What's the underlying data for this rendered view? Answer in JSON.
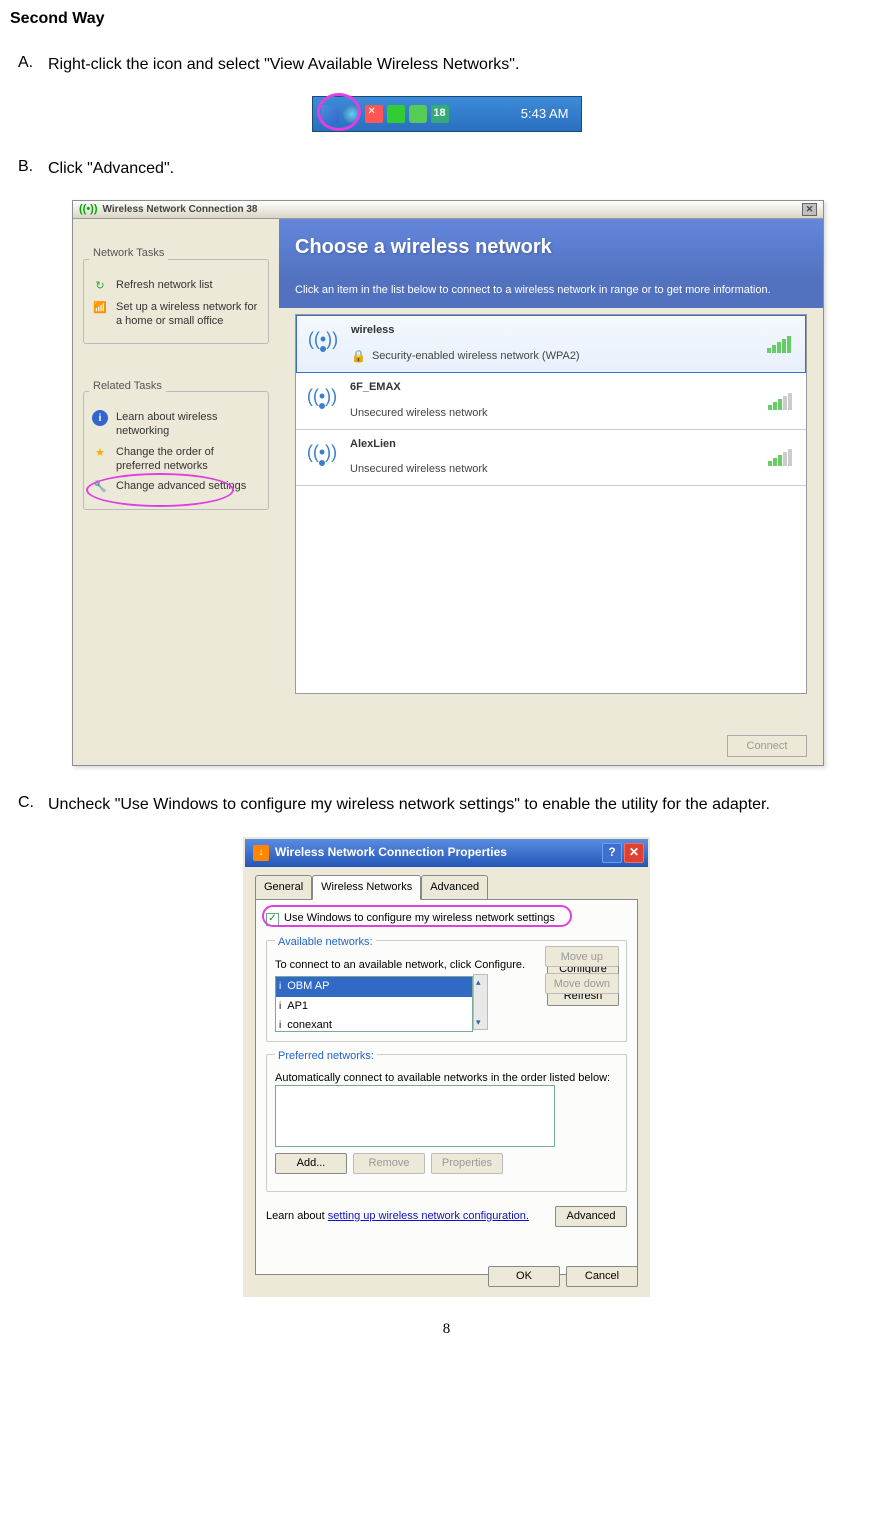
{
  "doc": {
    "heading": "Second Way",
    "stepA_letter": "A.",
    "stepA_text": "Right-click the icon and select \"View Available Wireless Networks\".",
    "stepB_letter": "B.",
    "stepB_text": "Click \"Advanced\".",
    "stepC_letter": "C.",
    "stepC_text": "Uncheck \"Use Windows to configure my wireless network settings\" to enable the utility for the adapter.",
    "pageNumber": "8"
  },
  "tray": {
    "langCode": "18",
    "time": "5:43 AM"
  },
  "fig1": {
    "title": "Wireless Network Connection 38",
    "sidebar": {
      "networkTasksLabel": "Network Tasks",
      "relatedTasksLabel": "Related Tasks",
      "tasks": {
        "refresh": "Refresh network list",
        "setup": "Set up a wireless network for a home or small office",
        "learn": "Learn about wireless networking",
        "order": "Change the order of preferred networks",
        "advanced": "Change advanced settings"
      }
    },
    "main": {
      "chooseTitle": "Choose a wireless network",
      "instruction": "Click an item in the list below to connect to a wireless network in range or to get more information.",
      "networks": [
        {
          "name": "wireless",
          "detail": "Security-enabled wireless network (WPA2)",
          "secure": true,
          "bars": 5,
          "selected": true
        },
        {
          "name": "6F_EMAX",
          "detail": "Unsecured wireless network",
          "secure": false,
          "bars": 3,
          "selected": false
        },
        {
          "name": "AlexLien",
          "detail": "Unsecured wireless network",
          "secure": false,
          "bars": 3,
          "selected": false
        }
      ],
      "connectBtn": "Connect"
    }
  },
  "fig2": {
    "title": "Wireless Network Connection Properties",
    "tabs": {
      "general": "General",
      "wireless": "Wireless Networks",
      "advanced": "Advanced"
    },
    "useWindows": "Use Windows to configure my wireless network settings",
    "availableLabel": "Available networks:",
    "availableText": "To connect to an available network, click Configure.",
    "availableItems": [
      "OBM AP",
      "AP1",
      "conexant"
    ],
    "configureBtn": "Configure",
    "refreshBtn": "Refresh",
    "preferredLabel": "Preferred networks:",
    "preferredText": "Automatically connect to available networks in the order listed below:",
    "moveUpBtn": "Move up",
    "moveDownBtn": "Move down",
    "addBtn": "Add...",
    "removeBtn": "Remove",
    "propertiesBtn": "Properties",
    "learnPrefix": "Learn about ",
    "learnLink": "setting up wireless network configuration.",
    "advancedBtn": "Advanced",
    "okBtn": "OK",
    "cancelBtn": "Cancel"
  }
}
